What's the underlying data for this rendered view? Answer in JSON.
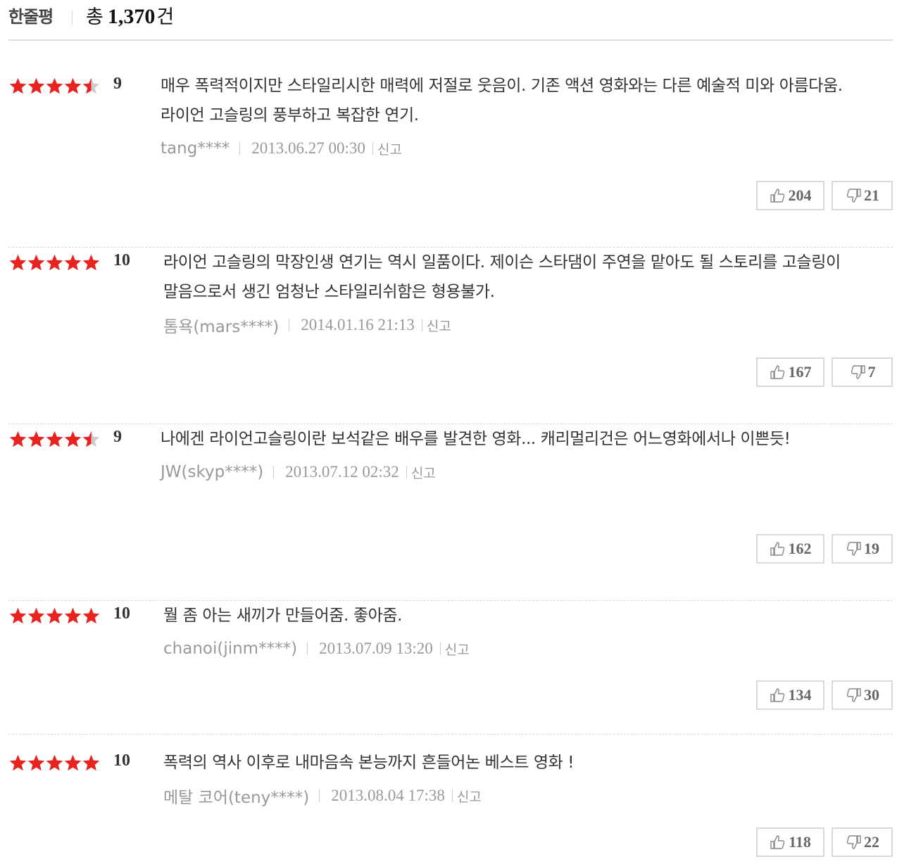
{
  "header": {
    "title": "한줄평",
    "total_prefix": "총",
    "total_count": "1,370",
    "total_suffix": "건"
  },
  "colors": {
    "star_filled": "#e8221e",
    "star_empty": "#cccccc",
    "meta_text": "#999999",
    "comment_text": "#333333"
  },
  "reviews": [
    {
      "stars": 4.5,
      "score": "9",
      "comment": "매우 폭력적이지만 스타일리시한 매력에 저절로 웃음이. 기존 액션 영화와는 다른 예술적 미와 아름다움. 라이언 고슬링의 풍부하고 복잡한 연기.",
      "author": "tang****",
      "date": "2013.06.27 00:30",
      "report": "신고",
      "likes": "204",
      "dislikes": "21"
    },
    {
      "stars": 5,
      "score": "10",
      "comment": "라이언 고슬링의 막장인생 연기는 역시 일품이다. 제이슨 스타댐이 주연을 맡아도 될 스토리를 고슬링이 말음으로서 생긴 엄청난 스타일리쉬함은 형용불가.",
      "author": "톰욕(mars****)",
      "date": "2014.01.16 21:13",
      "report": "신고",
      "likes": "167",
      "dislikes": "7"
    },
    {
      "stars": 4.5,
      "score": "9",
      "comment": "나에겐 라이언고슬링이란 보석같은 배우를 발견한 영화... 캐리멀리건은 어느영화에서나 이쁜듯!",
      "author": "JW(skyp****)",
      "date": "2013.07.12 02:32",
      "report": "신고",
      "likes": "162",
      "dislikes": "19"
    },
    {
      "stars": 5,
      "score": "10",
      "comment": "뭘 좀 아는 새끼가 만들어줌. 좋아줌.",
      "author": "chanoi(jinm****)",
      "date": "2013.07.09 13:20",
      "report": "신고",
      "likes": "134",
      "dislikes": "30"
    },
    {
      "stars": 5,
      "score": "10",
      "comment": "폭력의 역사 이후로 내마음속 본능까지 흔들어논 베스트 영화 !",
      "author": "메탈 코어(teny****)",
      "date": "2013.08.04 17:38",
      "report": "신고",
      "likes": "118",
      "dislikes": "22"
    }
  ]
}
